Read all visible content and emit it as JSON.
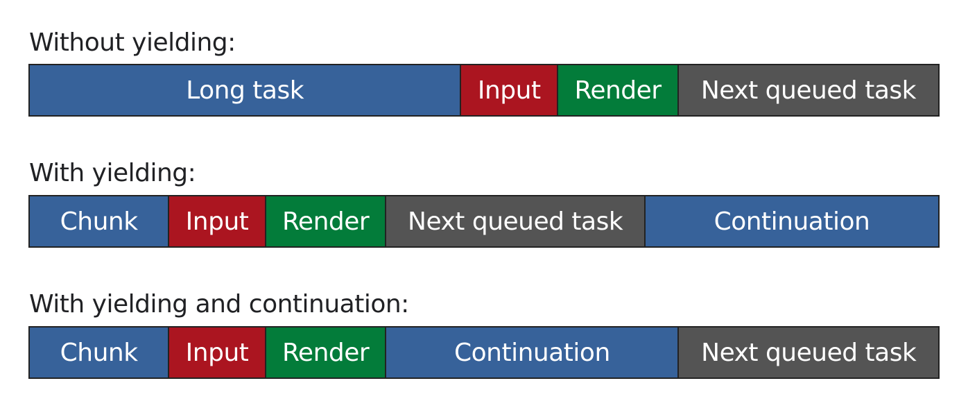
{
  "colors": {
    "task": "#37629a",
    "input": "#ab1520",
    "render": "#037c3a",
    "queued": "#545454",
    "border": "#222222"
  },
  "rows": [
    {
      "label": "Without yielding:",
      "segments": [
        {
          "label": "Long task",
          "kind": "blue",
          "weight": 625
        },
        {
          "label": "Input",
          "kind": "red",
          "weight": 139
        },
        {
          "label": "Render",
          "kind": "green",
          "weight": 173
        },
        {
          "label": "Next queued task",
          "kind": "gray",
          "weight": 377
        }
      ]
    },
    {
      "label": "With yielding:",
      "segments": [
        {
          "label": "Chunk",
          "kind": "blue",
          "weight": 201
        },
        {
          "label": "Input",
          "kind": "red",
          "weight": 139
        },
        {
          "label": "Render",
          "kind": "green",
          "weight": 173
        },
        {
          "label": "Next queued task",
          "kind": "gray",
          "weight": 375
        },
        {
          "label": "Continuation",
          "kind": "blue",
          "weight": 426
        }
      ]
    },
    {
      "label": "With yielding and continuation:",
      "segments": [
        {
          "label": "Chunk",
          "kind": "blue",
          "weight": 201
        },
        {
          "label": "Input",
          "kind": "red",
          "weight": 139
        },
        {
          "label": "Render",
          "kind": "green",
          "weight": 173
        },
        {
          "label": "Continuation",
          "kind": "blue",
          "weight": 424
        },
        {
          "label": "Next queued task",
          "kind": "gray",
          "weight": 377
        }
      ]
    }
  ]
}
